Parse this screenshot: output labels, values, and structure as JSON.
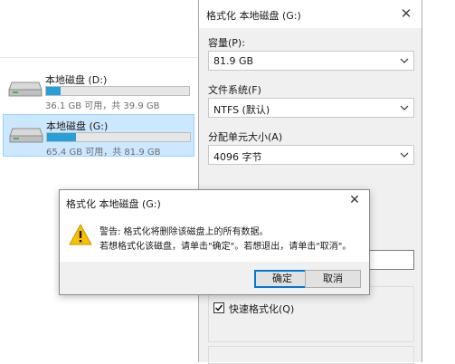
{
  "explorer": {
    "drives": [
      {
        "name": "本地磁盘 (D:)",
        "free": "36.1 GB 可用，共 39.9 GB",
        "used_fraction": 0.1,
        "selected": false
      },
      {
        "name": "本地磁盘 (G:)",
        "free": "65.4 GB 可用，共 81.9 GB",
        "used_fraction": 0.2,
        "selected": true
      }
    ]
  },
  "format_panel": {
    "title": "格式化 本地磁盘 (G:)",
    "capacity_label": "容量(P):",
    "capacity_value": "81.9 GB",
    "filesystem_label": "文件系统(F)",
    "filesystem_value": "NTFS (默认)",
    "allocation_label": "分配单元大小(A)",
    "allocation_value": "4096 字节",
    "quick_format_label": "快速格式化(Q)",
    "quick_format_checked": true
  },
  "dialog": {
    "title": "格式化 本地磁盘 (G:)",
    "message_line1": "警告: 格式化将删除该磁盘上的所有数据。",
    "message_line2": "若想格式化该磁盘，请单击\"确定\"。若想退出，请单击\"取消\"。",
    "ok_label": "确定",
    "cancel_label": "取消"
  },
  "colors": {
    "selection": "#cce8ff",
    "progress": "#26a0da",
    "accent": "#0078d7",
    "warning": "#f7c000"
  },
  "icons": {
    "drive": "hard-drive-icon",
    "warning": "warning-icon",
    "close": "close-icon",
    "dropdown": "chevron-down-icon"
  }
}
